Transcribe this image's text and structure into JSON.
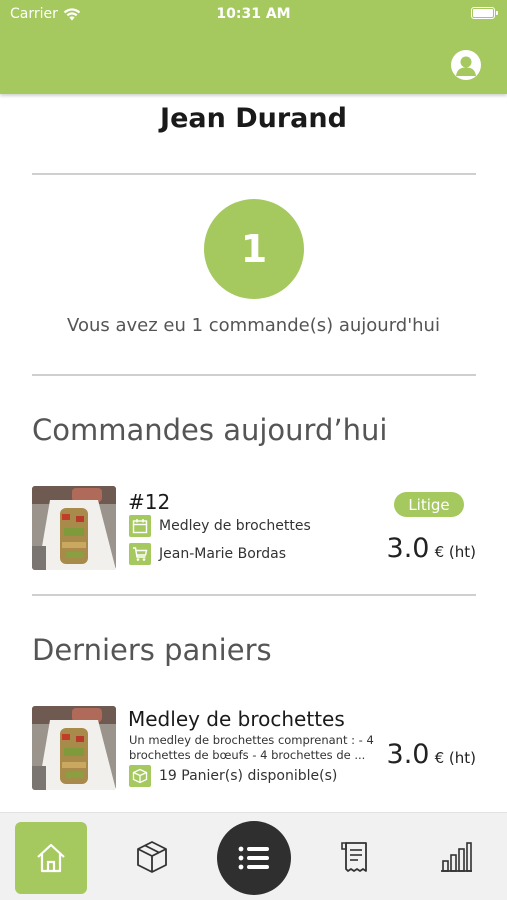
{
  "status_bar": {
    "carrier": "Carrier",
    "time": "10:31 AM"
  },
  "header": {
    "profile_icon": "user-avatar-icon",
    "accent_color": "#a5c95f"
  },
  "user": {
    "name": "Jean Durand"
  },
  "summary": {
    "count": "1",
    "text": "Vous avez eu 1 commande(s) aujourd'hui"
  },
  "orders_section": {
    "title": "Commandes aujourd’hui",
    "orders": [
      {
        "number": "#12",
        "product": "Medley de brochettes",
        "customer": "Jean-Marie Bordas",
        "status": "Litige",
        "price": "3.0",
        "price_unit": "€ (ht)"
      }
    ]
  },
  "baskets_section": {
    "title": "Derniers paniers",
    "baskets": [
      {
        "title": "Medley de brochettes",
        "description": "Un medley de brochettes comprenant : - 4 brochettes de bœufs - 4 brochettes de ...",
        "availability": "19 Panier(s) disponible(s)",
        "price": "3.0",
        "price_unit": "€ (ht)"
      }
    ]
  },
  "tabbar": {
    "items": [
      {
        "icon": "home-icon",
        "active": true
      },
      {
        "icon": "box-icon",
        "active": false
      },
      {
        "icon": "list-icon",
        "active": false
      },
      {
        "icon": "receipt-icon",
        "active": false
      },
      {
        "icon": "bar-chart-icon",
        "active": false
      }
    ]
  }
}
